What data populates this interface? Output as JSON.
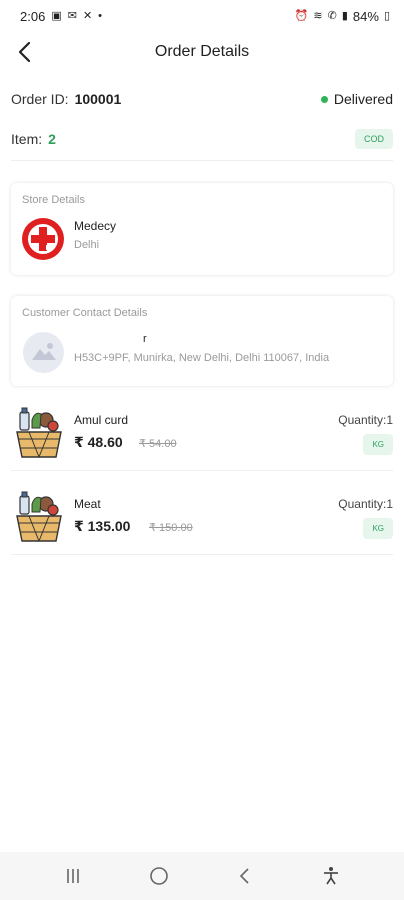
{
  "status_bar": {
    "time": "2:06",
    "battery": "84%"
  },
  "header": {
    "title": "Order Details"
  },
  "order": {
    "id_label": "Order ID:",
    "id_value": "100001",
    "status": "Delivered",
    "items_label": "Item:",
    "items_count": "2",
    "payment_badge": "COD"
  },
  "store": {
    "section_title": "Store Details",
    "name": "Medecy",
    "city": "Delhi"
  },
  "customer": {
    "section_title": "Customer Contact Details",
    "name": "r",
    "address": "H53C+9PF, Munirka, New Delhi, Delhi 110067, India"
  },
  "products": [
    {
      "name": "Amul curd",
      "price": "₹ 48.60",
      "old_price": "₹ 54.00",
      "quantity": "Quantity:1",
      "unit": "KG"
    },
    {
      "name": "Meat",
      "price": "₹ 135.00",
      "old_price": "₹ 150.00",
      "quantity": "Quantity:1",
      "unit": "KG"
    }
  ],
  "colors": {
    "accent_green": "#2e9f5e",
    "badge_bg": "#e6f6ec",
    "status_dot": "#2eb35a",
    "store_logo": "#e02020"
  }
}
